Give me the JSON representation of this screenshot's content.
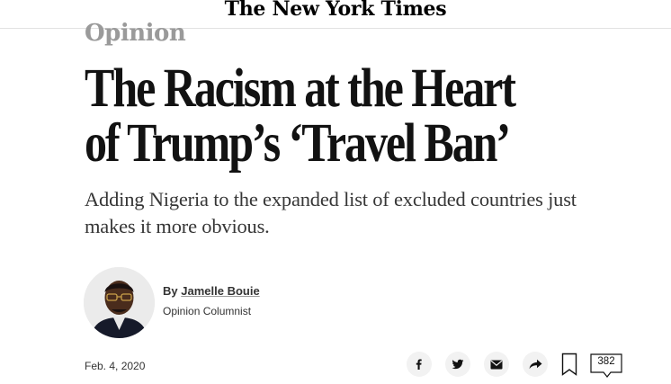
{
  "masthead": {
    "logo": "The New York Times"
  },
  "article": {
    "section": "Opinion",
    "headline_line1": "The Racism at the Heart",
    "headline_line2": "of Trump’s ‘Travel Ban’",
    "dek": "Adding Nigeria to the expanded list of excluded countries just makes it more obvious.",
    "byline_prefix": "By",
    "author": "Jamelle Bouie",
    "role": "Opinion Columnist",
    "date": "Feb. 4, 2020"
  },
  "toolbar": {
    "icons": [
      "facebook-icon",
      "twitter-icon",
      "email-icon",
      "share-icon",
      "bookmark-icon",
      "comment-icon"
    ],
    "comment_count": "382"
  }
}
